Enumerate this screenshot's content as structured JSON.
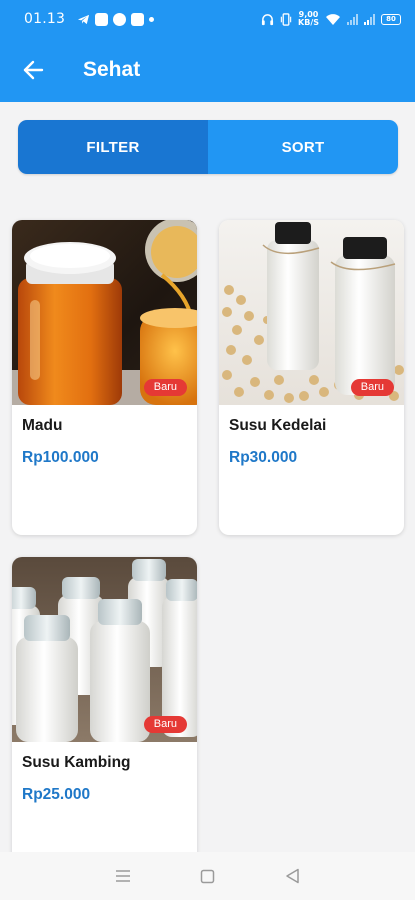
{
  "status_bar": {
    "time": "01.13",
    "speed_value": "9,00",
    "speed_unit": "KB/S",
    "battery": "80"
  },
  "app_bar": {
    "title": "Sehat",
    "color": "#2196f3"
  },
  "segment": {
    "filter_label": "FILTER",
    "sort_label": "SORT"
  },
  "products": [
    {
      "name": "Madu",
      "price": "Rp100.000",
      "badge": "Baru",
      "image": "honey-jar"
    },
    {
      "name": "Susu Kedelai",
      "price": "Rp30.000",
      "badge": "Baru",
      "image": "soy-milk-bottles"
    },
    {
      "name": "Susu Kambing",
      "price": "Rp25.000",
      "badge": "Baru",
      "image": "goat-milk-bottles"
    }
  ],
  "nav_bar": {
    "icons": [
      "menu-icon",
      "home-square-icon",
      "back-triangle-icon"
    ]
  }
}
